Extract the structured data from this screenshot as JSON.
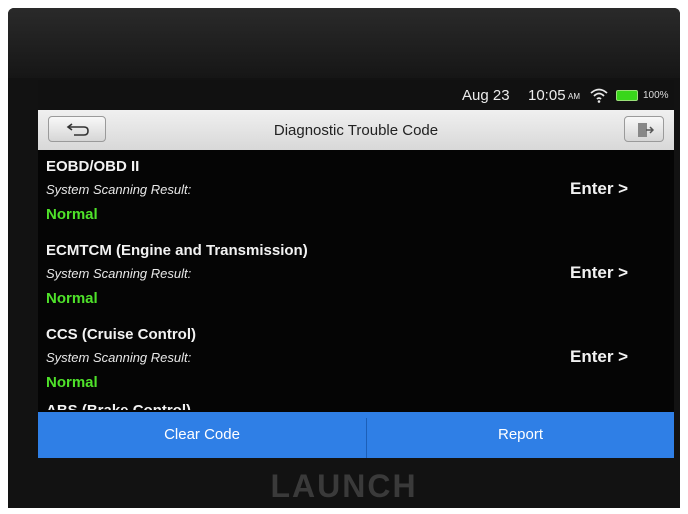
{
  "status_bar": {
    "date": "Aug 23",
    "time": "10:05",
    "ampm": "AM",
    "battery": "100%",
    "wifi_icon": "wifi-icon",
    "battery_icon": "battery-icon"
  },
  "header": {
    "title": "Diagnostic Trouble Code",
    "back_icon": "back-arrow-icon",
    "exit_icon": "exit-icon"
  },
  "systems": [
    {
      "name": "EOBD/OBD II",
      "scan_label": "System Scanning Result:",
      "status": "Normal",
      "action": "Enter >"
    },
    {
      "name": "ECMTCM (Engine and Transmission)",
      "scan_label": "System Scanning Result:",
      "status": "Normal",
      "action": "Enter >"
    },
    {
      "name": "CCS (Cruise Control)",
      "scan_label": "System Scanning Result:",
      "status": "Normal",
      "action": "Enter >"
    }
  ],
  "partial_item": "ABS (Brake Control)",
  "footer": {
    "clear_code": "Clear Code",
    "report": "Report"
  },
  "brand": "LAUNCH",
  "colors": {
    "status_normal": "#4fe22a",
    "action_bar": "#2f7fe6",
    "title_bar": "#e4e4e4"
  }
}
